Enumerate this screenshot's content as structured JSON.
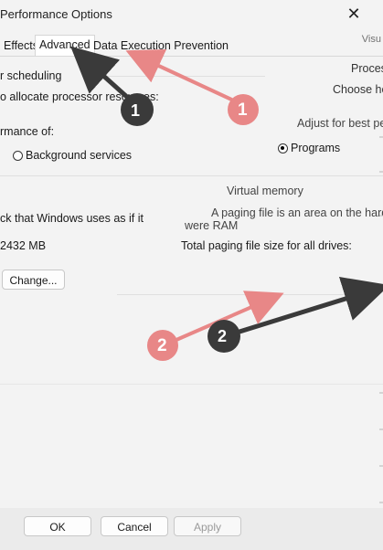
{
  "window": {
    "title": "Performance Options",
    "close_glyph": "✕",
    "visual_fragment": "Visu"
  },
  "tabs": [
    {
      "label": "Effects"
    },
    {
      "label": "Advanced"
    },
    {
      "label": "Data Execution Prevention"
    }
  ],
  "processor": {
    "heading": "r scheduling",
    "description": "o allocate processor resources:",
    "heading_right": "Proces",
    "choose_right": "Choose ho",
    "adjust_best": "Adjust for best performance of:",
    "performance_of": "rmance of:",
    "option_programs": "Programs",
    "option_background": "Background services"
  },
  "virtual_memory": {
    "heading": "Virtual memory",
    "paging_desc": "A paging file is an area on the hard disk",
    "ram_fragment": "were RAM",
    "total_label": "Total paging file size for all drives:",
    "windows_uses": "ck that Windows uses as if it",
    "size_value": "2432 MB",
    "change_label": "Change..."
  },
  "footer": {
    "ok": "OK",
    "cancel": "Cancel",
    "apply": "Apply"
  },
  "annotations": {
    "badge1": "1",
    "badge2": "2",
    "arrow_color": "#e35d5d",
    "arrow_shadow_color": "#3a3a3a"
  }
}
